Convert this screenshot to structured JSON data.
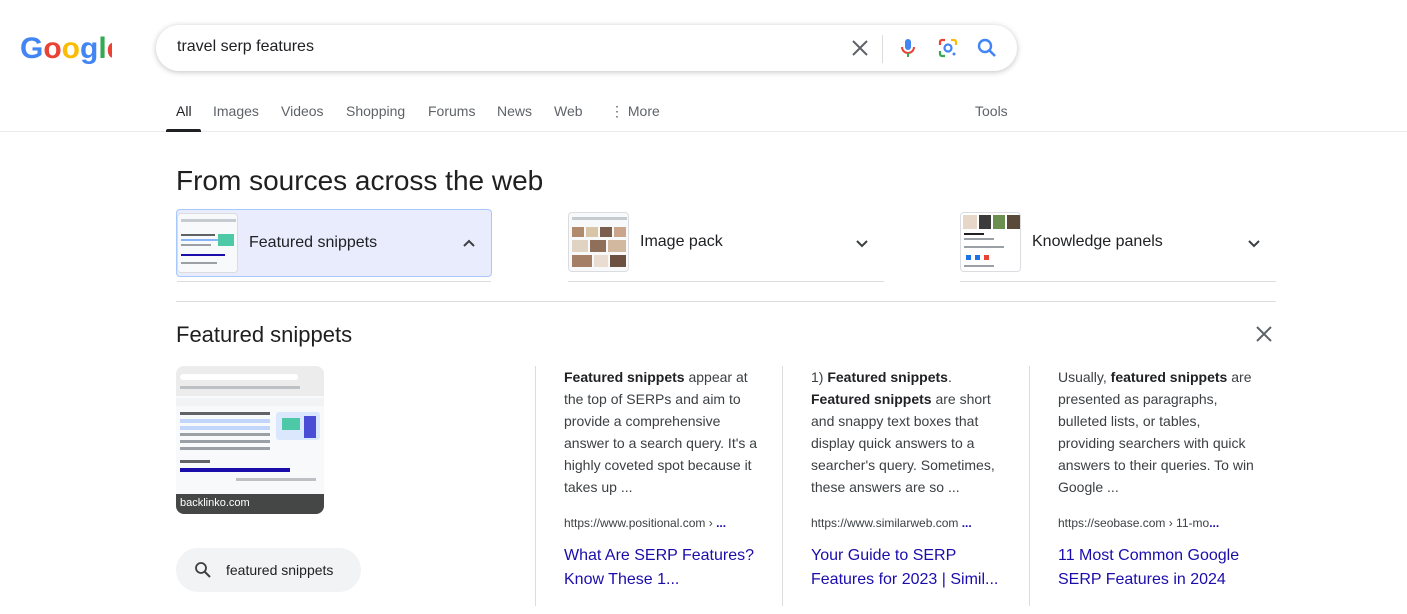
{
  "logo": {
    "text": "Google"
  },
  "search": {
    "query": "travel serp features"
  },
  "tabs": [
    {
      "label": "All"
    },
    {
      "label": "Images"
    },
    {
      "label": "Videos"
    },
    {
      "label": "Shopping"
    },
    {
      "label": "Forums"
    },
    {
      "label": "News"
    },
    {
      "label": "Web"
    },
    {
      "label": "More"
    }
  ],
  "tools_label": "Tools",
  "section_title": "From sources across the web",
  "chips": [
    {
      "label": "Featured snippets",
      "expanded": true
    },
    {
      "label": "Image pack",
      "expanded": false
    },
    {
      "label": "Knowledge panels",
      "expanded": false
    }
  ],
  "expanded": {
    "title": "Featured snippets",
    "thumb_source": "backlinko.com",
    "related_search": "featured snippets",
    "results": [
      {
        "text_html": "<b>Featured snippets</b> appear at the top of SERPs and aim to provide a comprehensive answer to a search query. It's a highly coveted spot because it takes up ...",
        "url": "https://www.positional.com › ...",
        "title": "What Are SERP Features? Know These 1..."
      },
      {
        "text_html": "1) <b>Featured snippets</b>. <b>Featured snippets</b> are short and snappy text boxes that display quick answers to a searcher's query. Sometimes, these answers are so ...",
        "url": "https://www.similarweb.com ...",
        "title": "Your Guide to SERP Features for 2023 | Simil..."
      },
      {
        "text_html": "Usually, <b>featured snippets</b> are presented as paragraphs, bulleted lists, or tables, providing searchers with quick answers to their queries. To win Google ...",
        "url": "https://seobase.com › 11-mo...",
        "title": "11 Most Common Google SERP Features in 2024"
      }
    ]
  },
  "colors": {
    "link": "#1a0dab",
    "chip_active_bg": "#e8ecfd",
    "blue": "#4285f4",
    "red": "#ea4335",
    "yellow": "#fbbc05",
    "green": "#34a853"
  }
}
